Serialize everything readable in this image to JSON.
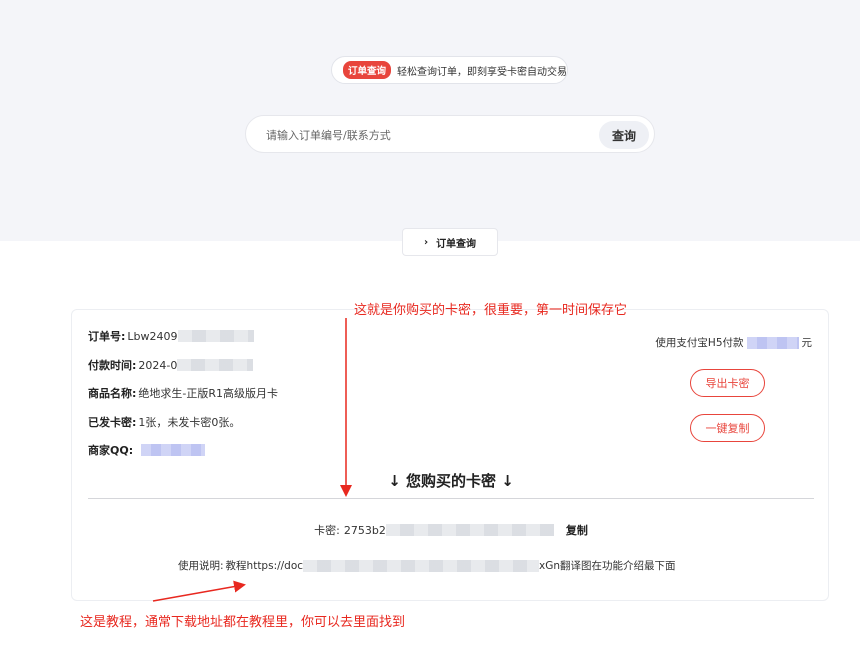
{
  "query": {
    "tag": "订单查询",
    "tagline": "轻松查询订单，即刻享受卡密自动交易",
    "search_placeholder": "请输入订单编号/联系方式",
    "search_button": "查询",
    "tab_label": "订单查询"
  },
  "order": {
    "order_no_label": "订单号:",
    "order_no_value": "Lbw2409",
    "pay_time_label": "付款时间:",
    "pay_time_value": "2024-0",
    "product_label": "商品名称:",
    "product_value": "绝地求生-正版R1高级版月卡",
    "issued_label": "已发卡密:",
    "issued_value": "1张，未发卡密0张。",
    "merchant_qq_label": "商家QQ:",
    "payment_prefix": "使用支付宝H5付款",
    "payment_suffix": "元",
    "export_button": "导出卡密",
    "copy_all_button": "一键复制"
  },
  "cards": {
    "heading": "↓ 您购买的卡密 ↓",
    "key_label": "卡密:",
    "key_value": "2753b2",
    "copy_button": "复制",
    "usage_label": "使用说明:",
    "usage_prefix": "教程https://doc",
    "usage_suffix": "xGn翻译图在功能介绍最下面"
  },
  "annotations": {
    "top": "这就是你购买的卡密，很重要，第一时间保存它",
    "bottom": "这是教程，通常下载地址都在教程里，你可以去里面找到"
  },
  "colors": {
    "accent": "#e8453c",
    "annotation": "#e8281f"
  }
}
